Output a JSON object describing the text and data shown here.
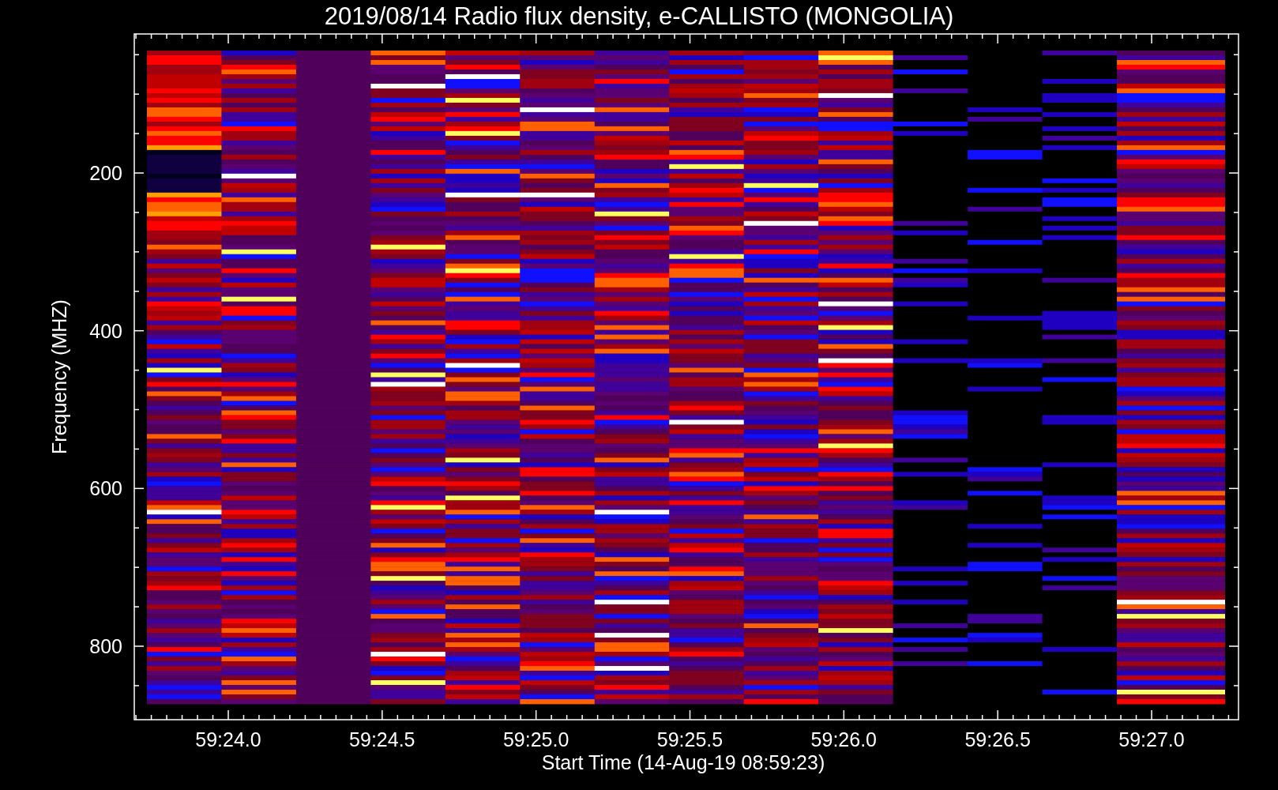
{
  "title": "2019/08/14  Radio flux density, e-CALLISTO (MONGOLIA)",
  "y_axis": {
    "label": "Frequency (MHZ)",
    "ticks": [
      "200",
      "400",
      "600",
      "800"
    ]
  },
  "x_axis": {
    "label": "Start Time (14-Aug-19 08:59:23)",
    "ticks": [
      "59:24.0",
      "59:24.5",
      "59:25.0",
      "59:25.5",
      "59:26.0",
      "59:26.5",
      "59:27.0"
    ]
  }
}
